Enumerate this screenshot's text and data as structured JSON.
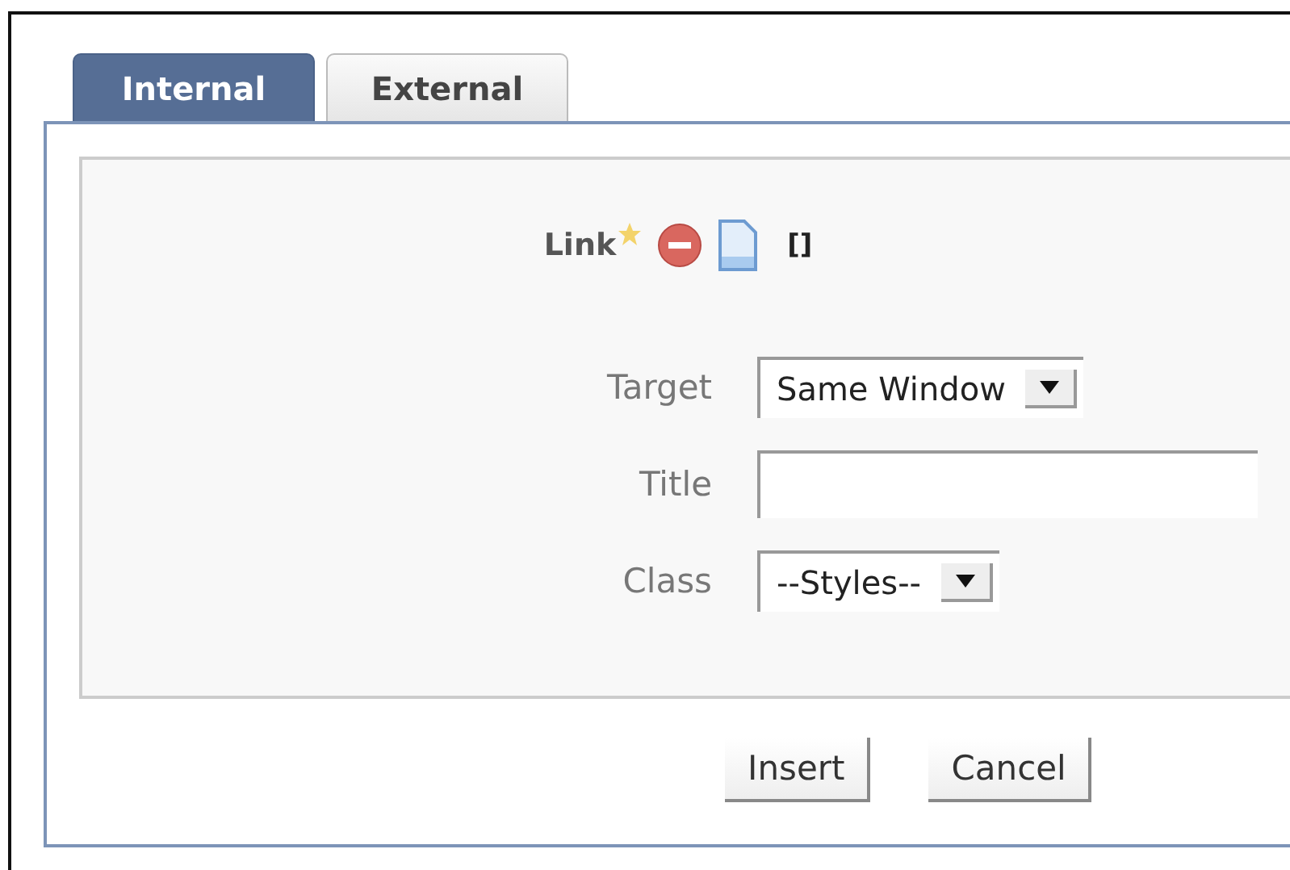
{
  "tabs": [
    {
      "label": "Internal",
      "selected": true
    },
    {
      "label": "External",
      "selected": false
    }
  ],
  "link": {
    "label": "Link",
    "required": true,
    "value": "[]"
  },
  "fields": [
    {
      "kind": "select",
      "label": "Target",
      "value": "Same Window"
    },
    {
      "kind": "text",
      "label": "Title"
    },
    {
      "kind": "select",
      "label": "Class",
      "value": "--Styles--"
    }
  ],
  "buttons": [
    "Insert",
    "Cancel"
  ]
}
